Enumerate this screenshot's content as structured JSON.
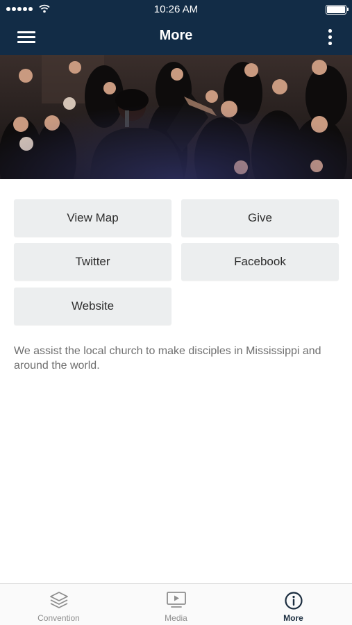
{
  "status_bar": {
    "time": "10:26 AM"
  },
  "nav": {
    "title": "More",
    "menu_icon": "hamburger-menu-icon",
    "more_icon": "kebab-menu-icon"
  },
  "hero": {
    "icon": "choir-photo"
  },
  "actions": [
    {
      "label": "View Map"
    },
    {
      "label": "Give"
    },
    {
      "label": "Twitter"
    },
    {
      "label": "Facebook"
    },
    {
      "label": "Website"
    }
  ],
  "description": "We assist the local church to make disciples in Mississippi and around the world.",
  "tabs": [
    {
      "label": "Convention",
      "icon": "layers-icon",
      "active": false
    },
    {
      "label": "Media",
      "icon": "play-screen-icon",
      "active": false
    },
    {
      "label": "More",
      "icon": "info-icon",
      "active": true
    }
  ],
  "colors": {
    "header": "#122c46",
    "button_bg": "#eceeef",
    "active_tab": "#1b2d3f",
    "inactive_tab": "#8e8e8e"
  }
}
